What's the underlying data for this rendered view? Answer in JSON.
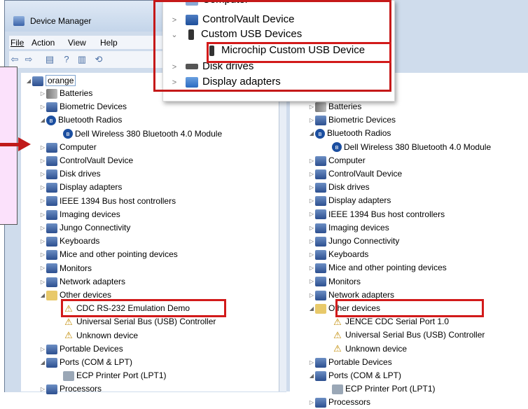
{
  "window": {
    "title": "Device Manager",
    "menu": [
      "File",
      "Action",
      "View",
      "Help"
    ]
  },
  "left_tree": {
    "root": "orange",
    "items": [
      {
        "label": "Batteries",
        "icon": "battery-icon",
        "level": 1
      },
      {
        "label": "Biometric Devices",
        "icon": "biometric-icon",
        "level": 1
      },
      {
        "label": "Bluetooth Radios",
        "icon": "bluetooth-icon",
        "level": 1,
        "expanded": true
      },
      {
        "label": "Dell Wireless 380 Bluetooth 4.0 Module",
        "icon": "bluetooth-icon",
        "level": 2
      },
      {
        "label": "Computer",
        "icon": "computer-icon",
        "level": 1
      },
      {
        "label": "ControlVault Device",
        "icon": "device-icon",
        "level": 1
      },
      {
        "label": "Disk drives",
        "icon": "disk-icon",
        "level": 1
      },
      {
        "label": "Display adapters",
        "icon": "display-icon",
        "level": 1
      },
      {
        "label": "IEEE 1394 Bus host controllers",
        "icon": "port-icon",
        "level": 1
      },
      {
        "label": "Imaging devices",
        "icon": "camera-icon",
        "level": 1
      },
      {
        "label": "Jungo Connectivity",
        "icon": "device-icon",
        "level": 1
      },
      {
        "label": "Keyboards",
        "icon": "keyboard-icon",
        "level": 1
      },
      {
        "label": "Mice and other pointing devices",
        "icon": "mouse-icon",
        "level": 1
      },
      {
        "label": "Monitors",
        "icon": "monitor-icon",
        "level": 1
      },
      {
        "label": "Network adapters",
        "icon": "network-icon",
        "level": 1
      },
      {
        "label": "Other devices",
        "icon": "unknown-icon",
        "level": 1,
        "expanded": true
      },
      {
        "label": "CDC RS-232 Emulation Demo",
        "icon": "warning-icon",
        "level": 2
      },
      {
        "label": "Universal Serial Bus (USB) Controller",
        "icon": "warning-icon",
        "level": 2
      },
      {
        "label": "Unknown device",
        "icon": "warning-icon",
        "level": 2
      },
      {
        "label": "Portable Devices",
        "icon": "portable-icon",
        "level": 1
      },
      {
        "label": "Ports (COM & LPT)",
        "icon": "port-icon",
        "level": 1,
        "expanded": true
      },
      {
        "label": "ECP Printer Port (LPT1)",
        "icon": "printer-icon",
        "level": 2
      },
      {
        "label": "Processors",
        "icon": "processor-icon",
        "level": 1
      }
    ]
  },
  "right_tree": {
    "items": [
      {
        "label": "Batteries",
        "icon": "battery-icon",
        "level": 1
      },
      {
        "label": "Biometric Devices",
        "icon": "biometric-icon",
        "level": 1
      },
      {
        "label": "Bluetooth Radios",
        "icon": "bluetooth-icon",
        "level": 1,
        "expanded": true
      },
      {
        "label": "Dell Wireless 380 Bluetooth 4.0 Module",
        "icon": "bluetooth-icon",
        "level": 2
      },
      {
        "label": "Computer",
        "icon": "computer-icon",
        "level": 1
      },
      {
        "label": "ControlVault Device",
        "icon": "device-icon",
        "level": 1
      },
      {
        "label": "Disk drives",
        "icon": "disk-icon",
        "level": 1
      },
      {
        "label": "Display adapters",
        "icon": "display-icon",
        "level": 1
      },
      {
        "label": "IEEE 1394 Bus host controllers",
        "icon": "port-icon",
        "level": 1
      },
      {
        "label": "Imaging devices",
        "icon": "camera-icon",
        "level": 1
      },
      {
        "label": "Jungo Connectivity",
        "icon": "device-icon",
        "level": 1
      },
      {
        "label": "Keyboards",
        "icon": "keyboard-icon",
        "level": 1
      },
      {
        "label": "Mice and other pointing devices",
        "icon": "mouse-icon",
        "level": 1
      },
      {
        "label": "Monitors",
        "icon": "monitor-icon",
        "level": 1
      },
      {
        "label": "Network adapters",
        "icon": "network-icon",
        "level": 1
      },
      {
        "label": "Other devices",
        "icon": "unknown-icon",
        "level": 1,
        "expanded": true
      },
      {
        "label": "JENCE CDC Serial Port 1.0",
        "icon": "warning-icon",
        "level": 2
      },
      {
        "label": "Universal Serial Bus (USB) Controller",
        "icon": "warning-icon",
        "level": 2
      },
      {
        "label": "Unknown device",
        "icon": "warning-icon",
        "level": 2
      },
      {
        "label": "Portable Devices",
        "icon": "portable-icon",
        "level": 1
      },
      {
        "label": "Ports (COM & LPT)",
        "icon": "port-icon",
        "level": 1,
        "expanded": true
      },
      {
        "label": "ECP Printer Port (LPT1)",
        "icon": "printer-icon",
        "level": 2
      },
      {
        "label": "Processors",
        "icon": "processor-icon",
        "level": 1
      }
    ]
  },
  "popup": {
    "items": [
      {
        "label": "Computer",
        "expander": "collapsed"
      },
      {
        "label": "ControlVault Device",
        "expander": "collapsed"
      },
      {
        "label": "Custom USB Devices",
        "expander": "expanded"
      },
      {
        "label": "Microchip Custom USB Device",
        "expander": "none"
      },
      {
        "label": "Disk drives",
        "expander": "collapsed"
      },
      {
        "label": "Display adapters",
        "expander": "collapsed"
      }
    ]
  },
  "colors": {
    "highlight": "#d21a1a",
    "callout_bg": "#fbe1fb"
  }
}
